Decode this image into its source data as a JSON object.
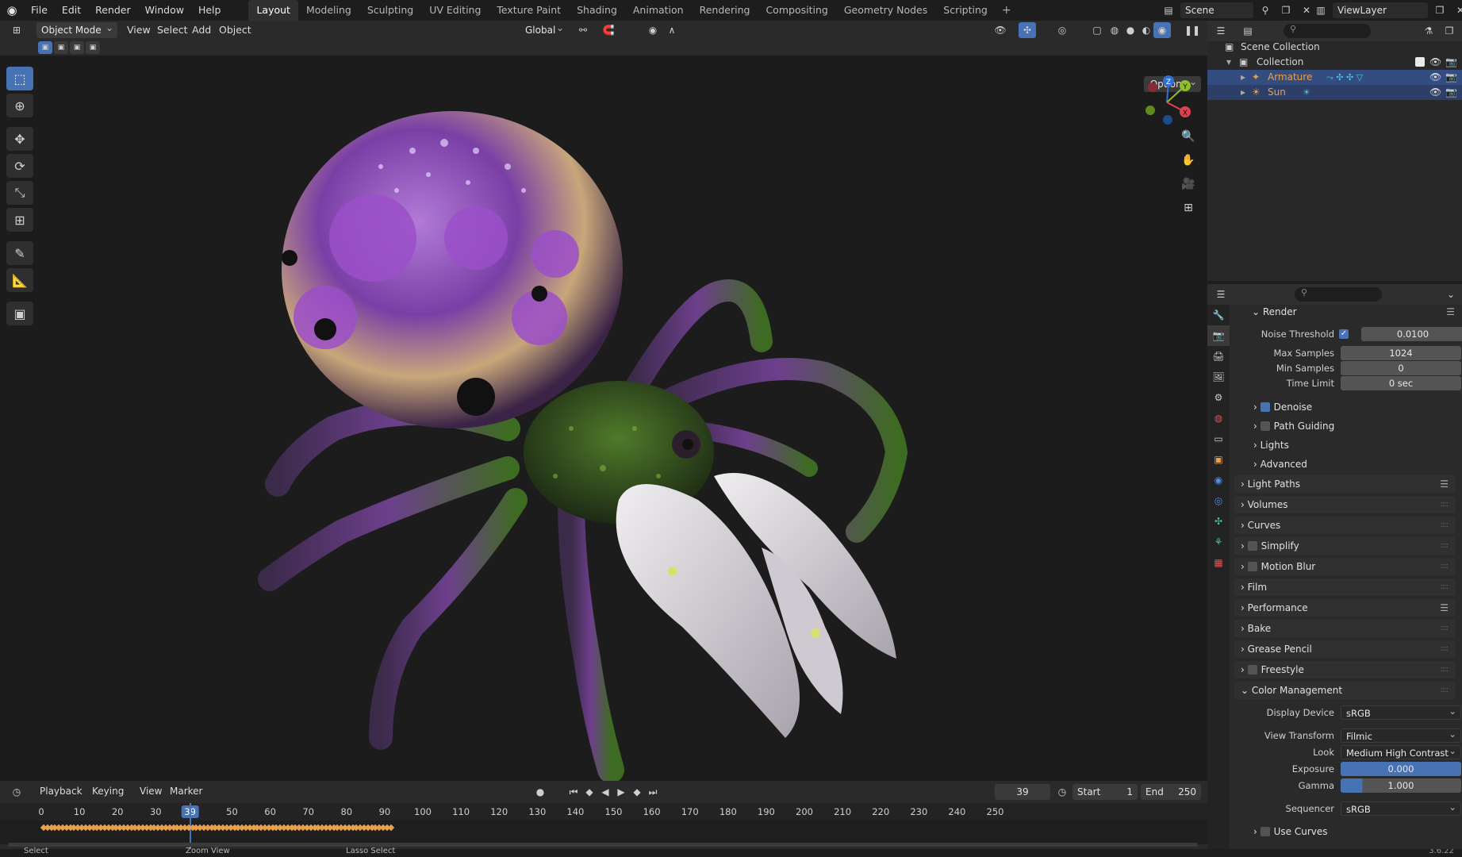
{
  "topbar": {
    "menus": [
      "File",
      "Edit",
      "Render",
      "Window",
      "Help"
    ],
    "workspaces": [
      "Layout",
      "Modeling",
      "Sculpting",
      "UV Editing",
      "Texture Paint",
      "Shading",
      "Animation",
      "Rendering",
      "Compositing",
      "Geometry Nodes",
      "Scripting"
    ],
    "active_workspace": "Layout",
    "scene": "Scene",
    "view_layer": "ViewLayer"
  },
  "viewport_header": {
    "mode": "Object Mode",
    "menus": [
      "View",
      "Select",
      "Add",
      "Object"
    ],
    "orientation": "Global",
    "options": "Options"
  },
  "gizmo": {
    "z": "Z",
    "y": "Y",
    "x": "X"
  },
  "timeline": {
    "menus": [
      "Playback",
      "Keying",
      "View",
      "Marker"
    ],
    "current_frame": "39",
    "start_label": "Start",
    "start": "1",
    "end_label": "End",
    "end": "250",
    "ticks": [
      "0",
      "10",
      "20",
      "30",
      "40",
      "50",
      "60",
      "70",
      "80",
      "90",
      "100",
      "110",
      "120",
      "130",
      "140",
      "150",
      "160",
      "170",
      "180",
      "190",
      "200",
      "210",
      "220",
      "230",
      "240",
      "250"
    ]
  },
  "status": {
    "select": "Select",
    "zoom": "Zoom View",
    "lasso": "Lasso Select",
    "version": "3.6.22"
  },
  "outliner": {
    "root": "Scene Collection",
    "collection": "Collection",
    "items": [
      {
        "name": "Armature"
      },
      {
        "name": "Sun"
      }
    ]
  },
  "properties": {
    "render_label": "Render",
    "noise_threshold_label": "Noise Threshold",
    "noise_threshold": "0.0100",
    "max_samples_label": "Max Samples",
    "max_samples": "1024",
    "min_samples_label": "Min Samples",
    "min_samples": "0",
    "time_limit_label": "Time Limit",
    "time_limit": "0 sec",
    "denoise": "Denoise",
    "path_guiding": "Path Guiding",
    "lights": "Lights",
    "advanced": "Advanced",
    "panels": [
      "Light Paths",
      "Volumes",
      "Curves",
      "Simplify",
      "Motion Blur",
      "Film",
      "Performance",
      "Bake",
      "Grease Pencil",
      "Freestyle",
      "Color Management"
    ],
    "display_device_label": "Display Device",
    "display_device": "sRGB",
    "view_transform_label": "View Transform",
    "view_transform": "Filmic",
    "look_label": "Look",
    "look": "Medium High Contrast",
    "exposure_label": "Exposure",
    "exposure": "0.000",
    "gamma_label": "Gamma",
    "gamma": "1.000",
    "sequencer_label": "Sequencer",
    "sequencer": "sRGB",
    "use_curves": "Use Curves"
  },
  "colors": {
    "accent": "#4772b3",
    "armature": "#e8a04c",
    "selected_row": "#334d80"
  }
}
